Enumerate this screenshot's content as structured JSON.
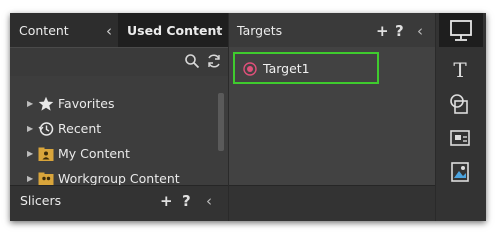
{
  "tabs": {
    "content": "Content",
    "used_content": "Used Content"
  },
  "tree": [
    {
      "label": "Favorites",
      "icon": "star-icon"
    },
    {
      "label": "Recent",
      "icon": "clock-history-icon"
    },
    {
      "label": "My Content",
      "icon": "user-folder-icon"
    },
    {
      "label": "Workgroup Content",
      "icon": "group-folder-icon"
    }
  ],
  "slicers": {
    "title": "Slicers"
  },
  "targets": {
    "title": "Targets",
    "items": [
      {
        "label": "Target1",
        "icon": "target-icon"
      }
    ]
  },
  "header_buttons": {
    "add": "+",
    "help": "?",
    "collapse": "‹"
  },
  "vertical_toolbar": [
    "monitor-icon",
    "text-icon",
    "shapes-icon",
    "image-icon",
    "media-icon"
  ],
  "colors": {
    "highlight": "#3fcb2e",
    "target_icon": "#e0507a",
    "folder": "#d9a53b"
  }
}
